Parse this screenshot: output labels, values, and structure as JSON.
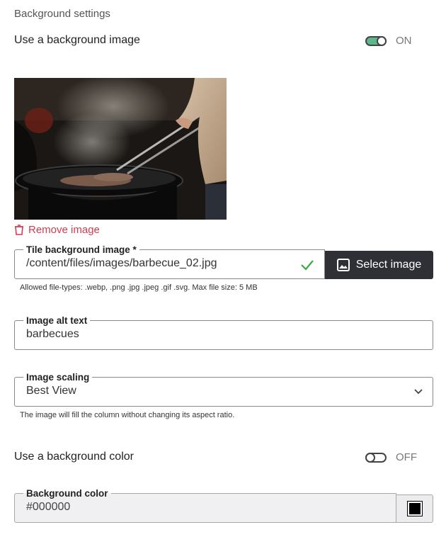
{
  "section": {
    "title": "Background settings"
  },
  "bg_image": {
    "toggle_label": "Use a background image",
    "toggle_state": "ON",
    "remove_label": "Remove image",
    "tile_field": {
      "legend": "Tile background image *",
      "value": "/content/files/images/barbecue_02.jpg",
      "select_label": "Select image",
      "help": "Allowed file-types: .webp, .png .jpg .jpeg .gif .svg. Max file size: 5 MB"
    },
    "alt_field": {
      "legend": "Image alt text",
      "value": "barbecues"
    },
    "scaling_field": {
      "legend": "Image scaling",
      "value": "Best View",
      "help": "The image will fill the column without changing its aspect ratio."
    }
  },
  "bg_color": {
    "toggle_label": "Use a background color",
    "toggle_state": "OFF",
    "color_field": {
      "legend": "Background color",
      "value": "#000000"
    }
  },
  "colors": {
    "toggle_on": "#5cb88a",
    "remove": "#d23b51",
    "select_button": "#2f3035",
    "valid_check": "#3aa845",
    "disabled_field": "#f0f0f2"
  },
  "icons": {
    "remove": "trash-icon",
    "valid": "check-icon",
    "select": "image-icon",
    "dropdown": "chevron-down-icon"
  }
}
